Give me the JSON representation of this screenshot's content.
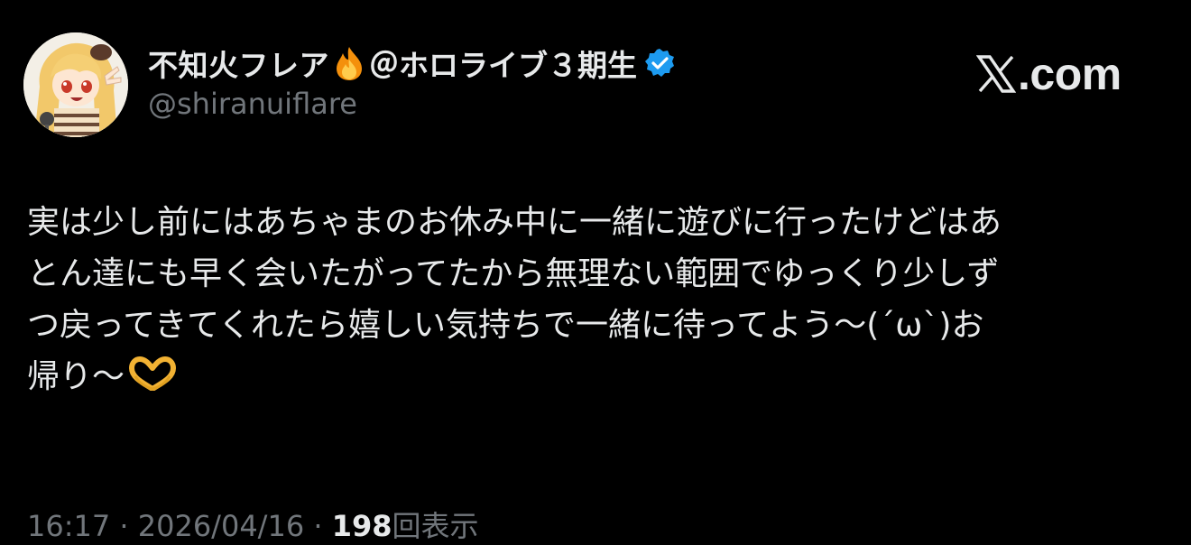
{
  "author": {
    "display_name": "不知火フレア",
    "display_name_suffix": "＠ホロライブ３期生",
    "handle": "@shiranuiflare",
    "name_emoji": "fire-icon",
    "badge": "verified-badge-icon",
    "badge_color": "#1d9bf0"
  },
  "brand": {
    "logo_icon": "x-logo-icon",
    "logo_text": ".com"
  },
  "tweet": {
    "lines": [
      "実は少し前にはあちゃまのお休み中に一緒に遊びに行ったけどはあ",
      "とん達にも早く会いたがってたから無理ない範囲でゆっくり少しず",
      "つ戻ってきてくれたら嬉しい気持ちで一緒に待ってよう〜(ˊωˋ)お",
      "帰り〜"
    ],
    "trailing_emoji": "heart-hands-icon"
  },
  "meta": {
    "time": "16:17",
    "separator": " · ",
    "date": "2026/04/16",
    "views_count": "198",
    "views_label": "回表示"
  },
  "colors": {
    "background": "#000000",
    "primary_text": "#e7e9ea",
    "secondary_text": "#71767b"
  }
}
